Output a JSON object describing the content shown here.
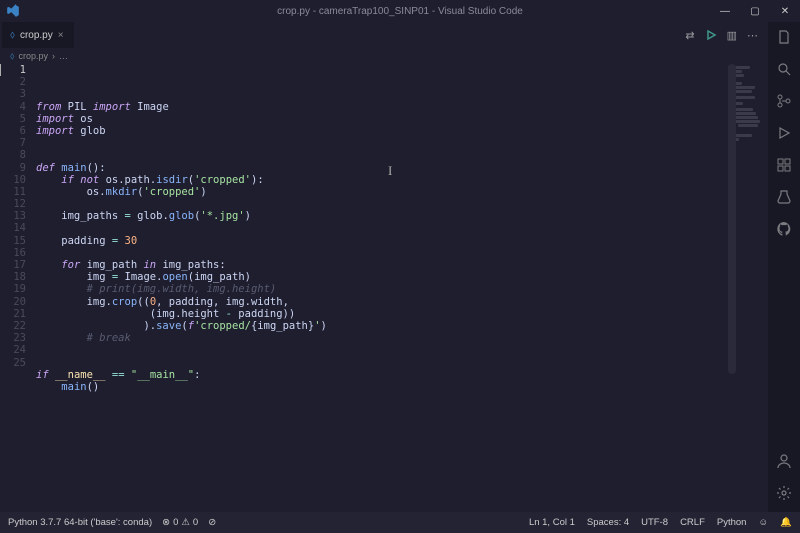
{
  "titlebar": {
    "title": "crop.py - cameraTrap100_SINP01 - Visual Studio Code"
  },
  "tab": {
    "filename": "crop.py"
  },
  "breadcrumb": {
    "file": "crop.py",
    "sep": "›",
    "more": "…"
  },
  "code": {
    "lines": [
      [
        {
          "c": "kw2",
          "t": "from"
        },
        {
          "c": "",
          "t": " PIL "
        },
        {
          "c": "kw2",
          "t": "import"
        },
        {
          "c": "",
          "t": " Image"
        }
      ],
      [
        {
          "c": "kw2",
          "t": "import"
        },
        {
          "c": "",
          "t": " os"
        }
      ],
      [
        {
          "c": "kw2",
          "t": "import"
        },
        {
          "c": "",
          "t": " glob"
        }
      ],
      [],
      [],
      [
        {
          "c": "kw",
          "t": "def"
        },
        {
          "c": "",
          "t": " "
        },
        {
          "c": "fn",
          "t": "main"
        },
        {
          "c": "",
          "t": "():"
        }
      ],
      [
        {
          "c": "",
          "t": "    "
        },
        {
          "c": "kw",
          "t": "if"
        },
        {
          "c": "",
          "t": " "
        },
        {
          "c": "kw",
          "t": "not"
        },
        {
          "c": "",
          "t": " os.path."
        },
        {
          "c": "fn",
          "t": "isdir"
        },
        {
          "c": "",
          "t": "("
        },
        {
          "c": "str",
          "t": "'cropped'"
        },
        {
          "c": "",
          "t": "):"
        }
      ],
      [
        {
          "c": "",
          "t": "        os."
        },
        {
          "c": "fn",
          "t": "mkdir"
        },
        {
          "c": "",
          "t": "("
        },
        {
          "c": "str",
          "t": "'cropped'"
        },
        {
          "c": "",
          "t": ")"
        }
      ],
      [],
      [
        {
          "c": "",
          "t": "    img_paths "
        },
        {
          "c": "op",
          "t": "="
        },
        {
          "c": "",
          "t": " glob."
        },
        {
          "c": "fn",
          "t": "glob"
        },
        {
          "c": "",
          "t": "("
        },
        {
          "c": "str",
          "t": "'*.jpg'"
        },
        {
          "c": "",
          "t": ")"
        }
      ],
      [],
      [
        {
          "c": "",
          "t": "    padding "
        },
        {
          "c": "op",
          "t": "="
        },
        {
          "c": "",
          "t": " "
        },
        {
          "c": "num",
          "t": "30"
        }
      ],
      [],
      [
        {
          "c": "",
          "t": "    "
        },
        {
          "c": "kw",
          "t": "for"
        },
        {
          "c": "",
          "t": " img_path "
        },
        {
          "c": "kw",
          "t": "in"
        },
        {
          "c": "",
          "t": " img_paths:"
        }
      ],
      [
        {
          "c": "",
          "t": "        img "
        },
        {
          "c": "op",
          "t": "="
        },
        {
          "c": "",
          "t": " Image."
        },
        {
          "c": "fn",
          "t": "open"
        },
        {
          "c": "",
          "t": "(img_path)"
        }
      ],
      [
        {
          "c": "",
          "t": "        "
        },
        {
          "c": "cmt",
          "t": "# print(img.width, img.height)"
        }
      ],
      [
        {
          "c": "",
          "t": "        img."
        },
        {
          "c": "fn",
          "t": "crop"
        },
        {
          "c": "",
          "t": "(("
        },
        {
          "c": "num",
          "t": "0"
        },
        {
          "c": "",
          "t": ", padding, img.width,"
        }
      ],
      [
        {
          "c": "",
          "t": "                  (img.height "
        },
        {
          "c": "op",
          "t": "-"
        },
        {
          "c": "",
          "t": " padding))"
        }
      ],
      [
        {
          "c": "",
          "t": "                 )."
        },
        {
          "c": "fn",
          "t": "save"
        },
        {
          "c": "",
          "t": "("
        },
        {
          "c": "kw",
          "t": "f"
        },
        {
          "c": "str",
          "t": "'cropped/"
        },
        {
          "c": "",
          "t": "{"
        },
        {
          "c": "var",
          "t": "img_path"
        },
        {
          "c": "",
          "t": "}"
        },
        {
          "c": "str",
          "t": "'"
        },
        {
          "c": "",
          "t": ")"
        }
      ],
      [
        {
          "c": "",
          "t": "        "
        },
        {
          "c": "cmt",
          "t": "# break"
        }
      ],
      [],
      [],
      [
        {
          "c": "kw",
          "t": "if"
        },
        {
          "c": "",
          "t": " "
        },
        {
          "c": "builtin",
          "t": "__name__"
        },
        {
          "c": "",
          "t": " "
        },
        {
          "c": "op",
          "t": "=="
        },
        {
          "c": "",
          "t": " "
        },
        {
          "c": "str",
          "t": "\"__main__\""
        },
        {
          "c": "",
          "t": ":"
        }
      ],
      [
        {
          "c": "",
          "t": "    "
        },
        {
          "c": "fn",
          "t": "main"
        },
        {
          "c": "",
          "t": "()"
        }
      ],
      []
    ],
    "line_count": 25
  },
  "status": {
    "python": "Python 3.7.7 64-bit ('base': conda)",
    "problems_a": "0",
    "problems_b": "0",
    "cursor": "Ln 1, Col 1",
    "spaces": "Spaces: 4",
    "encoding": "UTF-8",
    "eol": "CRLF",
    "lang": "Python",
    "feedback": "☺"
  },
  "icons": {
    "minimize": "—",
    "maximize": "▢",
    "close": "✕",
    "compare": "⇄",
    "run": "▷",
    "split": "▥",
    "more": "⋯",
    "tab_close": "×",
    "prohibited": "⊘",
    "bell": "🔔"
  }
}
